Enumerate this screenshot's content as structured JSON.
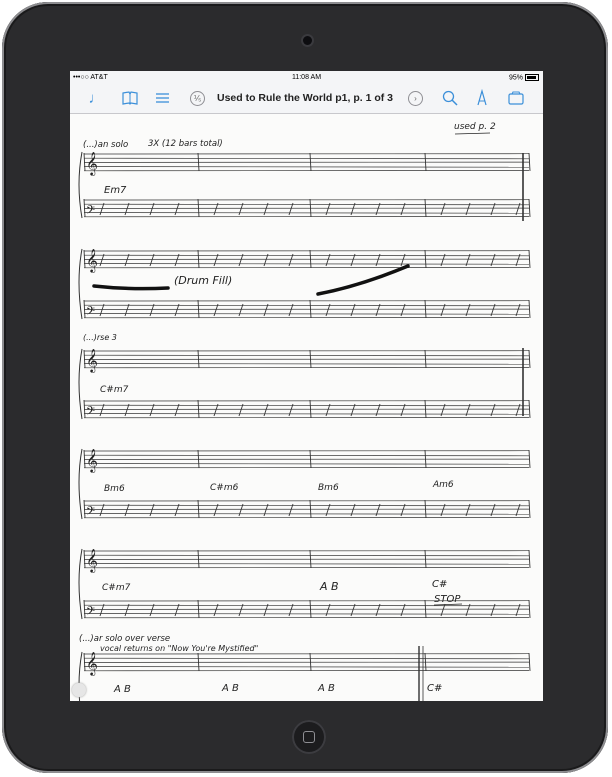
{
  "status": {
    "carrier": "•••○○ AT&T",
    "time": "11:08 AM",
    "battery": "95%"
  },
  "toolbar": {
    "title": "Used to Rule the World p1, p. 1 of 3",
    "prev_label": "⅟₅"
  },
  "score": {
    "top_right_note": "used p. 2",
    "sections": [
      {
        "label": "(...)an solo",
        "note": "3X  (12 bars total)",
        "chords": [
          "Em7"
        ]
      },
      {
        "label": "",
        "note": "(Drum Fill)",
        "chords": []
      },
      {
        "label": "(...)rse 3",
        "note": "",
        "chords": [
          "C#m7"
        ]
      },
      {
        "label": "",
        "note": "",
        "chords": [
          "Bm6",
          "C#m6",
          "Bm6",
          "Am6"
        ]
      },
      {
        "label": "",
        "note": "",
        "chords": [
          "C#m7",
          "A  B",
          "C#",
          "STOP"
        ]
      },
      {
        "label": "(...)ar solo over verse",
        "note": "vocal returns on \"Now You're Mystified\"",
        "chords": [
          "A  B",
          "A  B",
          "A  B",
          "C#"
        ]
      }
    ]
  }
}
